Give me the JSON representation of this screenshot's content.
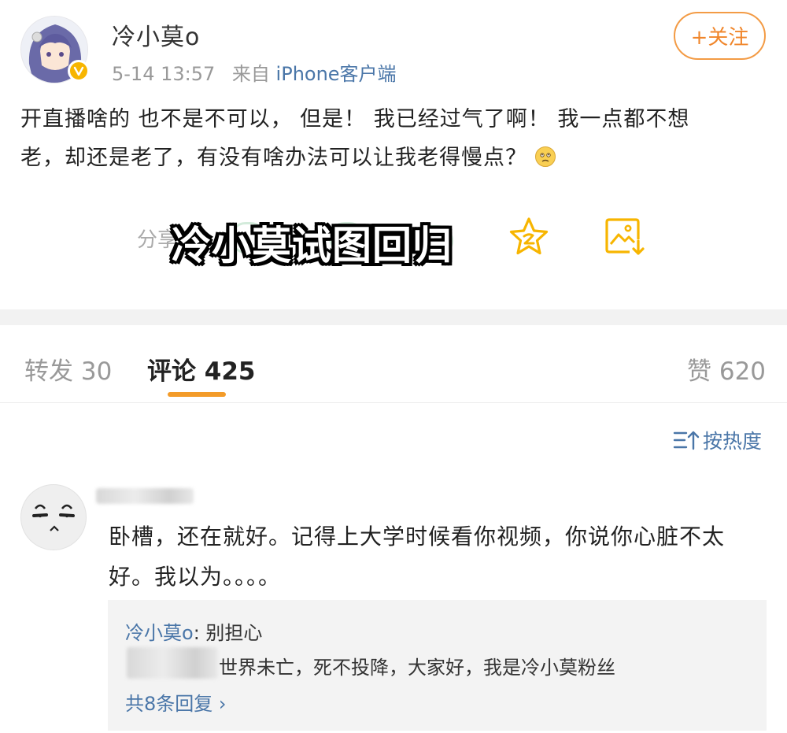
{
  "post": {
    "username": "冷小莫o",
    "time": "5-14 13:57",
    "from_prefix": "来自",
    "source": "iPhone客户端",
    "follow_label": "+关注",
    "text_line1": "开直播啥的 也不是不可以， 但是！ 我已经过气了啊！ 我一点都不想",
    "text_line2": "老，却还是老了，有没有啥办法可以让我老得慢点？"
  },
  "actions": {
    "share_label": "分享",
    "overlay_title": "冷小莫试图回归"
  },
  "tabs": {
    "repost": "转发 30",
    "comments": "评论 425",
    "likes": "赞 620"
  },
  "sort_label": "按热度",
  "comment": {
    "line1": "卧槽，还在就好。记得上大学时候看你视频，你说你心脏不太",
    "line2": "好。我以为。。。。",
    "reply": {
      "name": "冷小莫o",
      "text": ": 别担心",
      "second_text": "世界未亡，死不投降，大家好，我是冷小莫粉丝",
      "more": "共8条回复 ›"
    }
  },
  "colors": {
    "accent_orange": "#f39b29",
    "link_blue": "#4a76a8",
    "badge_gold": "#f7b500"
  },
  "icons": [
    "user-avatar",
    "verified-badge-icon",
    "emoji-icon",
    "star-icon",
    "save-image-icon",
    "sort-icon",
    "chevron-right-icon"
  ]
}
